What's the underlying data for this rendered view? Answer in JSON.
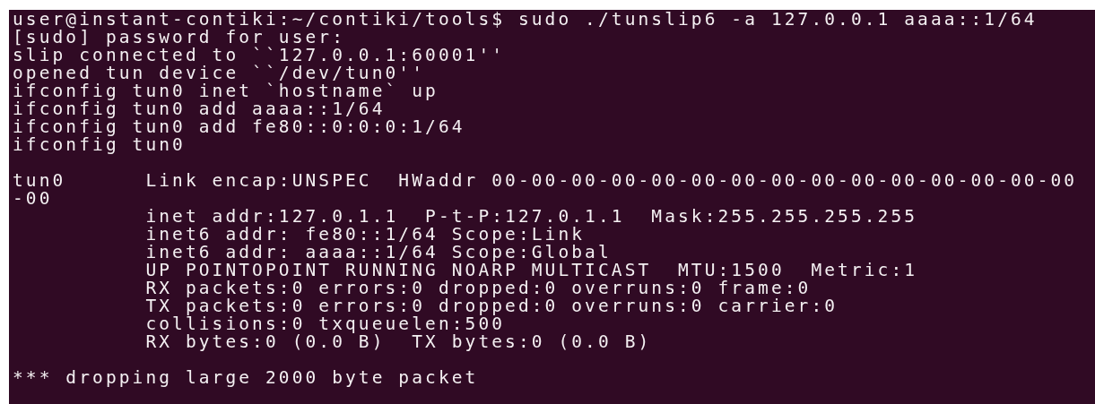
{
  "terminal": {
    "blocks": [
      {
        "lines": [
          "user@instant-contiki:~/contiki/tools$ sudo ./tunslip6 -a 127.0.0.1 aaaa::1/64",
          "[sudo] password for user:",
          "slip connected to ``127.0.0.1:60001''",
          "opened tun device ``/dev/tun0''",
          "ifconfig tun0 inet `hostname` up",
          "ifconfig tun0 add aaaa::1/64",
          "ifconfig tun0 add fe80::0:0:0:1/64",
          "ifconfig tun0"
        ]
      },
      {
        "lines": [
          "tun0      Link encap:UNSPEC  HWaddr 00-00-00-00-00-00-00-00-00-00-00-00-00-00-00",
          "-00",
          "          inet addr:127.0.1.1  P-t-P:127.0.1.1  Mask:255.255.255.255",
          "          inet6 addr: fe80::1/64 Scope:Link",
          "          inet6 addr: aaaa::1/64 Scope:Global",
          "          UP POINTOPOINT RUNNING NOARP MULTICAST  MTU:1500  Metric:1",
          "          RX packets:0 errors:0 dropped:0 overruns:0 frame:0",
          "          TX packets:0 errors:0 dropped:0 overruns:0 carrier:0",
          "          collisions:0 txqueuelen:500",
          "          RX bytes:0 (0.0 B)  TX bytes:0 (0.0 B)"
        ]
      },
      {
        "lines": [
          "*** dropping large 2000 byte packet"
        ]
      }
    ]
  }
}
